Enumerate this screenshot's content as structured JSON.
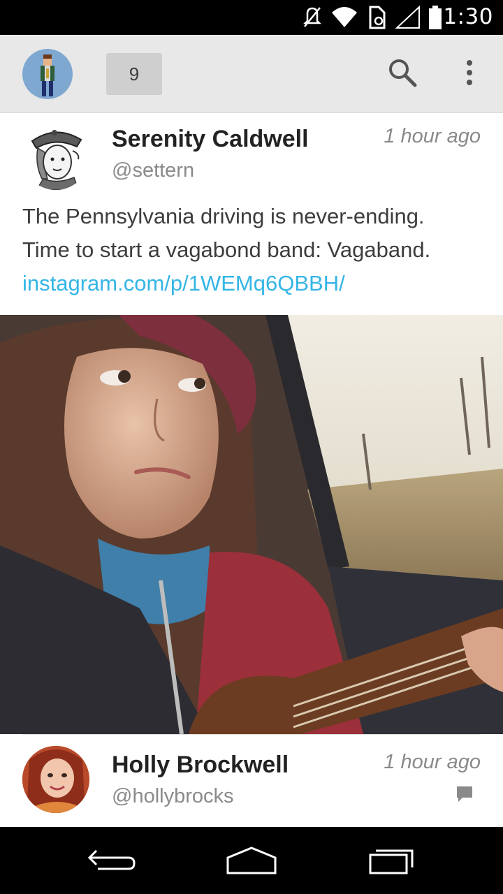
{
  "status_bar": {
    "time": "1:30",
    "icons": [
      "mute-icon",
      "wifi-icon",
      "nfc-icon",
      "signal-icon",
      "battery-icon"
    ]
  },
  "action_bar": {
    "account_avatar": "pixel-art-avatar",
    "unread_count": "9",
    "icons": [
      "search-icon",
      "overflow-menu-icon"
    ]
  },
  "timeline": [
    {
      "name": "Serenity Caldwell",
      "handle": "@settern",
      "time": "1 hour ago",
      "text_line1": "The Pennsylvania driving is never-ending.",
      "text_line2": "Time to start a vagabond band: Vagaband.",
      "link": "instagram.com/p/1WEMq6QBBH/",
      "avatar": "cartoon-girl-with-cap"
    },
    {
      "name": "Holly Brockwell",
      "handle": "@hollybrocks",
      "time": "1 hour ago",
      "avatar": "red-haired-woman-photo",
      "icons": [
        "conversation-icon"
      ]
    }
  ],
  "nav_bar": {
    "icons": [
      "back-icon",
      "home-icon",
      "recents-icon"
    ]
  },
  "colors": {
    "link": "#34b5e5",
    "action_bar_bg": "#e8e8e8",
    "name_text": "#222222",
    "meta_text": "#8a8a8a"
  }
}
